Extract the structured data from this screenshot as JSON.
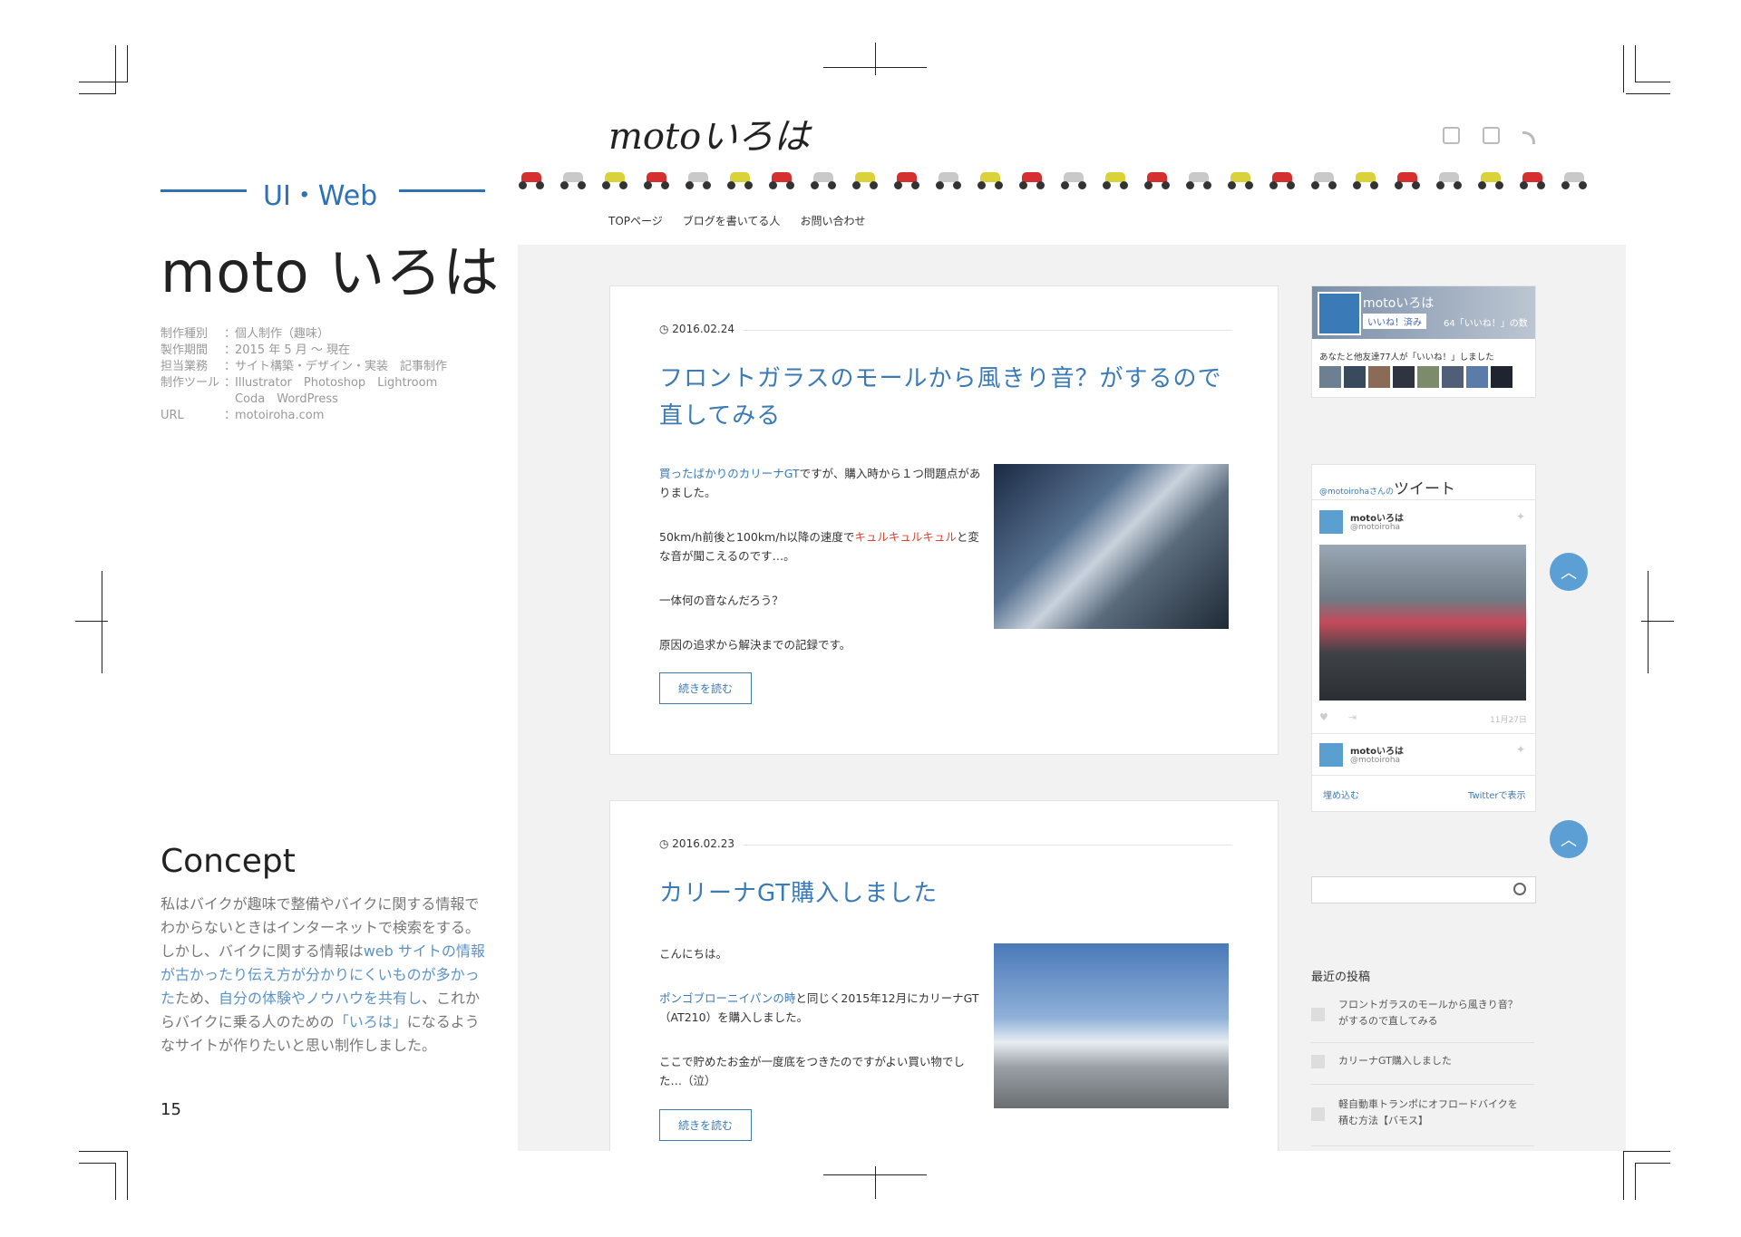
{
  "left_panel": {
    "category": "UI・Web",
    "title": "moto いろは",
    "specs": [
      {
        "key": "制作種別",
        "sep": "：",
        "value": "個人制作（趣味）"
      },
      {
        "key": "製作期間",
        "sep": "：",
        "value": "2015 年 5 月 〜 現在"
      },
      {
        "key": "担当業務",
        "sep": "：",
        "value": "サイト構築・デザイン・実装　記事制作"
      },
      {
        "key": "制作ツール",
        "sep": "：",
        "value": "Illustrator　Photoshop　Lightroom"
      },
      {
        "key": "",
        "sep": "",
        "value": "Coda　WordPress"
      },
      {
        "key": "URL",
        "sep": "：",
        "value": "motoiroha.com"
      }
    ],
    "concept_heading": "Concept",
    "concept": {
      "p1": "私はバイクが趣味で整備やバイクに関する情報でわからないときはインターネットで検索をする。しかし、バイクに関する情報は",
      "h1": "web サイトの情報が古かったり伝え方が分かりにくいものが多かった",
      "p2": "ため、",
      "h2": "自分の体験やノウハウを共有し",
      "p3": "、これからバイクに乗る人のための",
      "h3": "「いろは」",
      "p4": "になるようなサイトが作りたいと思い制作しました。"
    },
    "page_number": "15"
  },
  "site": {
    "logo": "motoいろは",
    "social_icons": [
      "facebook-icon",
      "twitter-icon",
      "rss-icon"
    ],
    "bike_colors": [
      "#d62f2f",
      "#c9c9c9",
      "#d9d23a"
    ],
    "nav": [
      "TOPページ",
      "ブログを書いてる人",
      "お問い合わせ"
    ],
    "accent": "#3a7ab6",
    "posts": [
      {
        "date": "2016.02.24",
        "title_line1": "フロントガラスのモールから風きり音？がするので",
        "title_line2": "直してみる",
        "p1_link": "買ったばかりのカリーナGT",
        "p1_rest": "ですが、購入時から１つ問題点がありました。",
        "p2_pre": "50km/h前後と100km/h以降の速度で",
        "p2_red": "キュルキュルキュル",
        "p2_post": "と変な音が聞こえるのです…。",
        "p3": "一体何の音なんだろう？",
        "p4": "原因の追求から解決までの記録です。",
        "more": "続きを読む"
      },
      {
        "date": "2016.02.23",
        "title": "カリーナGT購入しました",
        "p1": "こんにちは。",
        "p2_link": "ポンゴブローニイパンの時",
        "p2_rest": "と同じく2015年12月にカリーナGT（AT210）を購入しました。",
        "p3": "ここで貯めたお金が一度底をつきたのですがよい買い物でした…（泣）",
        "more": "続きを読む"
      }
    ],
    "fb_widget": {
      "name": "motoいろは",
      "like_btn": "いいね！済み",
      "count": "64「いいね！」の数",
      "friends": "あなたと他友達77人が「いいね！」しました"
    },
    "twitter_widget": {
      "handle_prefix": "@motoirohaさんの",
      "title": "ツイート",
      "account": "motoいろは",
      "account_handle": "@motoiroha",
      "tweet_date": "11月27日",
      "embed": "埋め込む",
      "view": "Twitterで表示"
    },
    "recent_posts": {
      "heading": "最近の投稿",
      "items": [
        {
          "line1": "フロントガラスのモールから風きり音？",
          "line2": "がするので直してみる"
        },
        {
          "line1": "カリーナGT購入しました",
          "line2": ""
        },
        {
          "line1": "軽自動車トランポにオフロードバイクを",
          "line2": "積む方法【バモス】"
        }
      ]
    }
  }
}
